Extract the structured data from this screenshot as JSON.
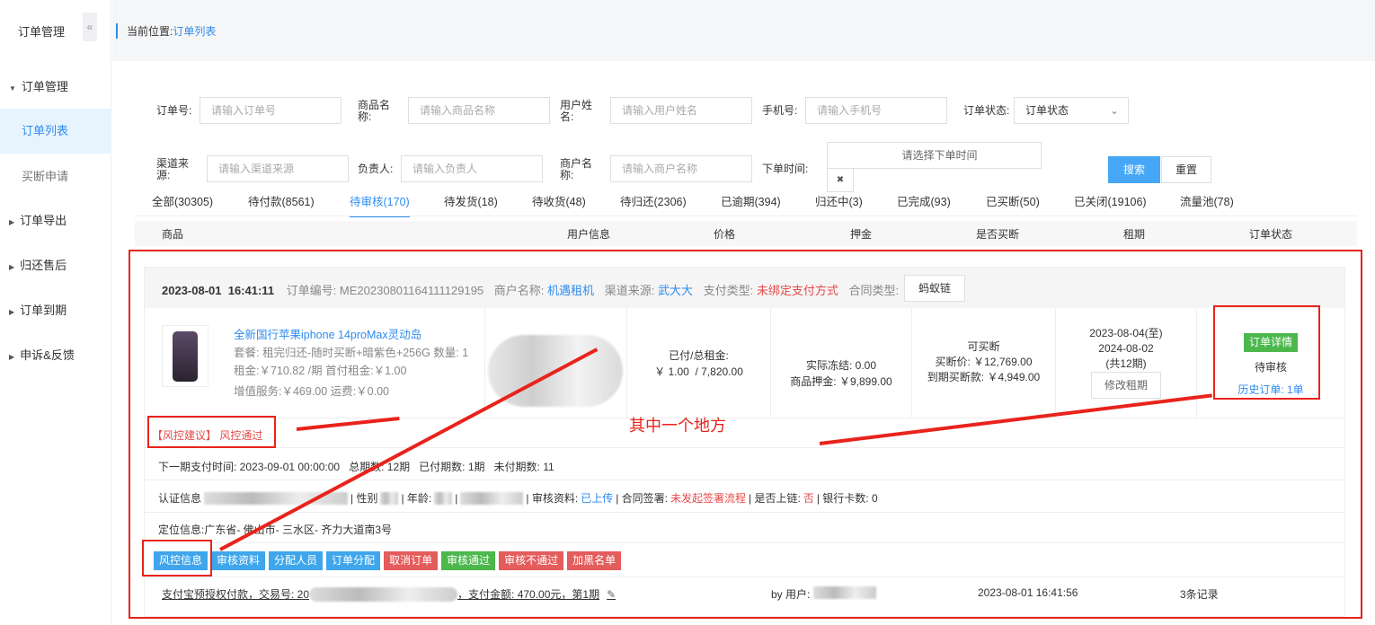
{
  "sidebar": {
    "title": "订单管理",
    "collapse_icon": "«",
    "items": [
      {
        "label": "订单管理",
        "expanded": true
      },
      {
        "label": "订单列表",
        "active": true
      },
      {
        "label": "买断申请"
      },
      {
        "label": "订单导出"
      },
      {
        "label": "归还售后"
      },
      {
        "label": "订单到期"
      },
      {
        "label": "申诉&反馈"
      }
    ]
  },
  "breadcrumb": {
    "prefix": "当前位置:",
    "current": "订单列表"
  },
  "filters": {
    "order_no": {
      "label": "订单号:",
      "placeholder": "请输入订单号"
    },
    "product": {
      "label": "商品名称:",
      "placeholder": "请输入商品名称"
    },
    "user": {
      "label": "用户姓名:",
      "placeholder": "请输入用户姓名"
    },
    "phone": {
      "label": "手机号:",
      "placeholder": "请输入手机号"
    },
    "status": {
      "label": "订单状态:",
      "value": "订单状态"
    },
    "channel": {
      "label": "渠道来源:",
      "placeholder": "请输入渠道来源"
    },
    "owner": {
      "label": "负责人:",
      "placeholder": "请输入负责人"
    },
    "merchant": {
      "label": "商户名称:",
      "placeholder": "请输入商户名称"
    },
    "time": {
      "label": "下单时间:",
      "placeholder": "请选择下单时间",
      "clear": "✖"
    },
    "search": "搜索",
    "reset": "重置"
  },
  "tabs": [
    "全部(30305)",
    "待付款(8561)",
    "待审核(170)",
    "待发货(18)",
    "待收货(48)",
    "待归还(2306)",
    "已逾期(394)",
    "归还中(3)",
    "已完成(93)",
    "已买断(50)",
    "已关闭(19106)",
    "流量池(78)"
  ],
  "table_headers": [
    "商品",
    "用户信息",
    "价格",
    "押金",
    "是否买断",
    "租期",
    "订单状态"
  ],
  "order": {
    "datetime": "2023-08-01  16:41:11",
    "order_no_label": "订单编号:",
    "order_no": "ME20230801164111129195",
    "merchant_label": "商户名称:",
    "merchant": "机遇租机",
    "channel_label": "渠道来源:",
    "channel": "武大大",
    "pay_type_label": "支付类型:",
    "pay_type": "未绑定支付方式",
    "contract_label": "合同类型:",
    "contract_btn": "蚂蚁链",
    "product_title": "全新国行苹果iphone 14proMax灵动岛",
    "package": "套餐: 租完归还-随时买断+暗紫色+256G 数量: 1",
    "rent": "租金:￥710.82 /期  首付租金:￥1.00",
    "extras": "增值服务:￥469.00  运费:￥0.00",
    "paid_label": "已付/总租金:",
    "paid": "￥ 1.00  / 7,820.00",
    "frozen": "实际冻结: 0.00",
    "deposit": "商品押金: ￥9,899.00",
    "buyout_status": "可买断",
    "buyout_price": "买断价: ￥12,769.00",
    "buyout_due": "到期买断款: ￥4,949.00",
    "term_start": "2023-08-04(至)",
    "term_end": "2024-08-02",
    "term_count": "(共12期)",
    "modify_term": "修改租期",
    "detail_btn": "订单详情",
    "status": "待审核",
    "history": "历史订单: 1单",
    "risk_label": "【风控建议】",
    "risk_value": "风控通过",
    "next_pay": "下一期支付时间: 2023-09-01 00:00:00",
    "total_periods": "总期数: 12期",
    "paid_periods": "已付期数: 1期",
    "unpaid_periods": "未付期数: 11",
    "auth_label": "认证信息",
    "gender_label": "| 性别",
    "age_label": "| 年龄:",
    "review_label": "| 审核资料:",
    "review_value": "已上传",
    "sign_label": "| 合同签署:",
    "sign_value": "未发起签署流程",
    "chain_label": "| 是否上链:",
    "chain_value": "否",
    "bank_label": "| 银行卡数: 0",
    "location": "定位信息:广东省- 佛山市- 三水区- 齐力大道南3号",
    "actions": [
      "风控信息",
      "审核资料",
      "分配人员",
      "订单分配",
      "取消订单",
      "审核通过",
      "审核不通过",
      "加黑名单"
    ],
    "payment_pre": "支付宝预授权付款，交易号: 20",
    "payment_post": "，支付金额: 470.00元，第1期",
    "by_user": "by 用户:",
    "pay_time": "2023-08-01 16:41:56",
    "records": "3条记录"
  },
  "annotation": "其中一个地方",
  "colors": {
    "accent": "#2d8cf0",
    "danger": "#e45c5c",
    "success": "#4cb84c",
    "annotation": "#e8231c"
  }
}
